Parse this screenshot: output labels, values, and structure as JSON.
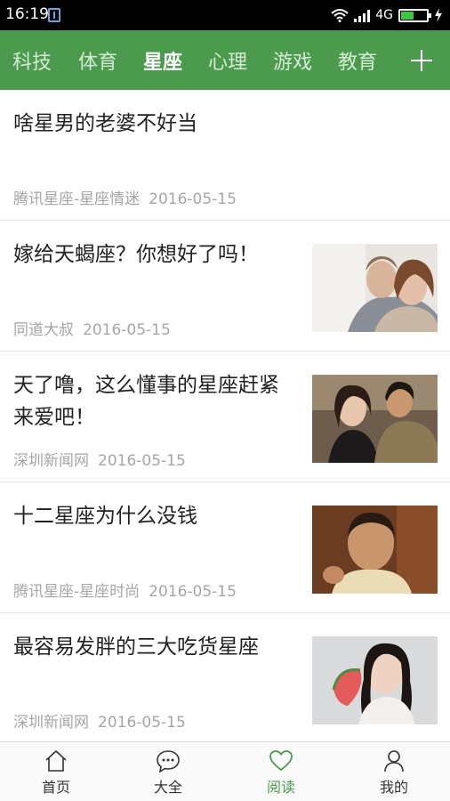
{
  "status": {
    "time": "16:19",
    "network": "4G",
    "battery_level": 0.46,
    "icons": [
      "usb-icon",
      "wifi-icon",
      "signal-icon",
      "battery-icon",
      "charging-icon"
    ]
  },
  "tabs": [
    {
      "label": "科技",
      "active": false
    },
    {
      "label": "体育",
      "active": false
    },
    {
      "label": "星座",
      "active": true
    },
    {
      "label": "心理",
      "active": false
    },
    {
      "label": "游戏",
      "active": false
    },
    {
      "label": "教育",
      "active": false
    }
  ],
  "add_channel_icon": "plus-icon",
  "articles": [
    {
      "title": "啥星男的老婆不好当",
      "source": "腾讯星座-星座情迷",
      "date": "2016-05-15",
      "thumbnail": null
    },
    {
      "title": "嫁给天蝎座？你想好了吗！",
      "source": "同道大叔",
      "date": "2016-05-15",
      "thumbnail": "couple-embrace-photo"
    },
    {
      "title": "天了噜，这么懂事的星座赶紧来爱吧！",
      "source": "深圳新闻网",
      "date": "2016-05-15",
      "thumbnail": "couple-talking-photo"
    },
    {
      "title": "十二星座为什么没钱",
      "source": "腾讯星座-星座时尚",
      "date": "2016-05-15",
      "thumbnail": "man-portrait-photo"
    },
    {
      "title": "最容易发胖的三大吃货星座",
      "source": "深圳新闻网",
      "date": "2016-05-15",
      "thumbnail": "woman-eating-watermelon-photo"
    }
  ],
  "bottom_nav": [
    {
      "label": "首页",
      "icon": "home-icon",
      "active": false
    },
    {
      "label": "大全",
      "icon": "chat-bubble-icon",
      "active": false
    },
    {
      "label": "阅读",
      "icon": "heart-icon",
      "active": true
    },
    {
      "label": "我的",
      "icon": "person-icon",
      "active": false
    }
  ],
  "colors": {
    "accent": "#4b9a4e",
    "status_bar": "#000000",
    "meta_text": "#a6a6a6"
  }
}
